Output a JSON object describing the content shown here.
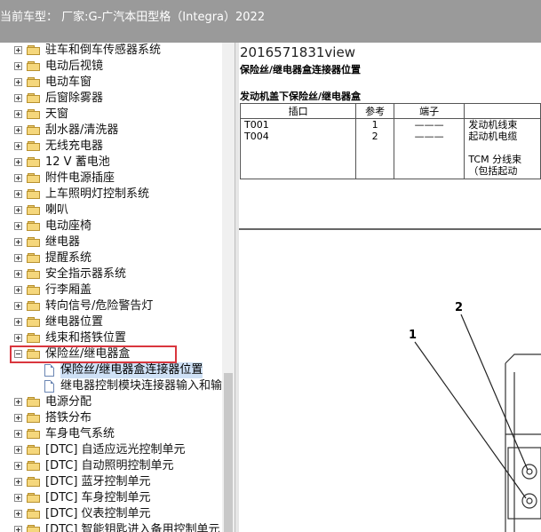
{
  "window": {
    "title": "当前车型：  厂家:G-广汽本田型格（Integra）2022"
  },
  "tree": [
    {
      "label": "驻车和倒车传感器系统",
      "type": "folder",
      "expand": "plus",
      "top": 0
    },
    {
      "label": "电动后视镜",
      "type": "folder",
      "expand": "plus"
    },
    {
      "label": "电动车窗",
      "type": "folder",
      "expand": "plus"
    },
    {
      "label": "后窗除雾器",
      "type": "folder",
      "expand": "plus"
    },
    {
      "label": "天窗",
      "type": "folder",
      "expand": "plus"
    },
    {
      "label": "刮水器/清洗器",
      "type": "folder",
      "expand": "plus"
    },
    {
      "label": "无线充电器",
      "type": "folder",
      "expand": "plus"
    },
    {
      "label": "12 V 蓄电池",
      "type": "folder",
      "expand": "plus"
    },
    {
      "label": "附件电源插座",
      "type": "folder",
      "expand": "plus"
    },
    {
      "label": "上车照明灯控制系统",
      "type": "folder",
      "expand": "plus"
    },
    {
      "label": "喇叭",
      "type": "folder",
      "expand": "plus"
    },
    {
      "label": "电动座椅",
      "type": "folder",
      "expand": "plus"
    },
    {
      "label": "继电器",
      "type": "folder",
      "expand": "plus"
    },
    {
      "label": "提醒系统",
      "type": "folder",
      "expand": "plus"
    },
    {
      "label": "安全指示器系统",
      "type": "folder",
      "expand": "plus"
    },
    {
      "label": "行李厢盖",
      "type": "folder",
      "expand": "plus"
    },
    {
      "label": "转向信号/危险警告灯",
      "type": "folder",
      "expand": "plus"
    },
    {
      "label": "继电器位置",
      "type": "folder",
      "expand": "plus"
    },
    {
      "label": "线束和搭铁位置",
      "type": "folder",
      "expand": "plus"
    },
    {
      "label": "保险丝/继电器盒",
      "type": "folder",
      "expand": "minus"
    },
    {
      "label": "保险丝/继电器盒连接器位置",
      "type": "doc",
      "selected": true
    },
    {
      "label": "继电器控制模块连接器输入和输",
      "type": "doc"
    },
    {
      "label": "电源分配",
      "type": "folder",
      "expand": "plus"
    },
    {
      "label": "搭铁分布",
      "type": "folder",
      "expand": "plus"
    },
    {
      "label": "车身电气系统",
      "type": "folder",
      "expand": "plus"
    },
    {
      "label": "[DTC] 自适应远光控制单元",
      "type": "folder",
      "expand": "plus"
    },
    {
      "label": "[DTC] 自动照明控制单元",
      "type": "folder",
      "expand": "plus"
    },
    {
      "label": "[DTC] 蓝牙控制单元",
      "type": "folder",
      "expand": "plus"
    },
    {
      "label": "[DTC] 车身控制单元",
      "type": "folder",
      "expand": "plus"
    },
    {
      "label": "[DTC] 仪表控制单元",
      "type": "folder",
      "expand": "plus"
    },
    {
      "label": "[DTC] 智能钥匙进入备用控制单元",
      "type": "folder",
      "expand": "plus"
    }
  ],
  "content": {
    "doc_id": "2016571831view",
    "doc_title": "保险丝/继电器盒连接器位置",
    "section_title": "发动机盖下保险丝/继电器盒",
    "table": {
      "headers": [
        "插口",
        "参考",
        "端子",
        ""
      ],
      "connectors": [
        "T001",
        "T004"
      ],
      "refs": [
        "1",
        "2"
      ],
      "terminals": [
        "———",
        "———"
      ],
      "desc_lines": [
        "发动机线束",
        "起动机电缆",
        "",
        "TCM 分线束",
        "（包括起动"
      ]
    },
    "callouts": [
      "1",
      "2"
    ]
  }
}
